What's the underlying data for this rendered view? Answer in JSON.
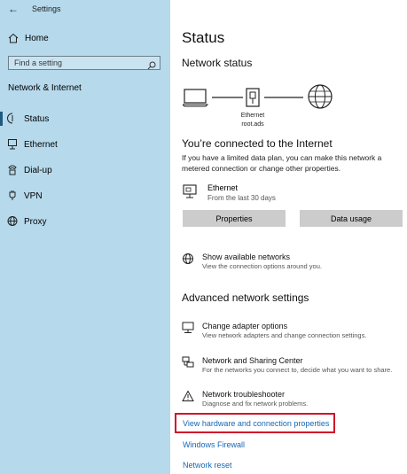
{
  "window": {
    "title": "Settings"
  },
  "sidebar": {
    "home_label": "Home",
    "search_placeholder": "Find a setting",
    "section_title": "Network & Internet",
    "items": [
      {
        "label": "Status",
        "icon": "status-icon",
        "active": true
      },
      {
        "label": "Ethernet",
        "icon": "ethernet-icon",
        "active": false
      },
      {
        "label": "Dial-up",
        "icon": "dialup-icon",
        "active": false
      },
      {
        "label": "VPN",
        "icon": "vpn-icon",
        "active": false
      },
      {
        "label": "Proxy",
        "icon": "proxy-icon",
        "active": false
      }
    ]
  },
  "main": {
    "title": "Status",
    "network_status_heading": "Network status",
    "diagram": {
      "ethernet_label": "Ethernet",
      "domain_label": "root.ads"
    },
    "connected_heading": "You’re connected to the Internet",
    "connected_desc": "If you have a limited data plan, you can make this network a metered connection or change other properties.",
    "connection": {
      "name": "Ethernet",
      "usage": "From the last 30 days"
    },
    "buttons": {
      "properties": "Properties",
      "data_usage": "Data usage"
    },
    "show_networks": {
      "title": "Show available networks",
      "subtitle": "View the connection options around you."
    },
    "advanced_heading": "Advanced network settings",
    "advanced_items": [
      {
        "title": "Change adapter options",
        "subtitle": "View network adapters and change connection settings.",
        "icon": "adapter-icon"
      },
      {
        "title": "Network and Sharing Center",
        "subtitle": "For the networks you connect to, decide what you want to share.",
        "icon": "sharing-icon"
      },
      {
        "title": "Network troubleshooter",
        "subtitle": "Diagnose and fix network problems.",
        "icon": "warning-icon"
      }
    ],
    "links": {
      "hardware": "View hardware and connection properties",
      "firewall": "Windows Firewall",
      "reset": "Network reset"
    }
  },
  "colors": {
    "sidebar_bg": "#b6d9ec",
    "link": "#1668b4",
    "highlight": "#d0142a",
    "button_bg": "#cccccc"
  }
}
